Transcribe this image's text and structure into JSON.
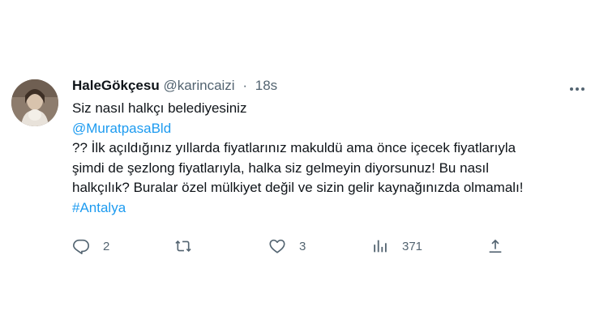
{
  "tweet": {
    "display_name": "HaleGökçesu",
    "handle": "@karincaizi",
    "separator": "·",
    "time": "18s",
    "text_line1": "Siz nasıl halkçı belediyesiniz",
    "mention": "@MuratpasaBld",
    "text_line3": "?? İlk açıldığınız yıllarda fiyatlarınız makuldü ama önce içecek fiyatlarıyla",
    "text_line4": "şimdi de şezlong fiyatlarıyla, halka siz gelmeyin diyorsunuz! Bu nasıl",
    "text_line5": "halkçılık? Buralar özel mülkiyet değil ve sizin gelir kaynağınızda olmamalı!",
    "hashtag": "#Antalya"
  },
  "actions": {
    "replies": "2",
    "retweets": "",
    "likes": "3",
    "views": "371"
  },
  "icons": {
    "reply": "reply-icon",
    "retweet": "retweet-icon",
    "like": "heart-icon",
    "views": "views-chart-icon",
    "share": "share-upload-icon",
    "more": "more-dots-icon"
  },
  "colors": {
    "link": "#1d9bf0",
    "text": "#0f1419",
    "muted": "#536471"
  }
}
